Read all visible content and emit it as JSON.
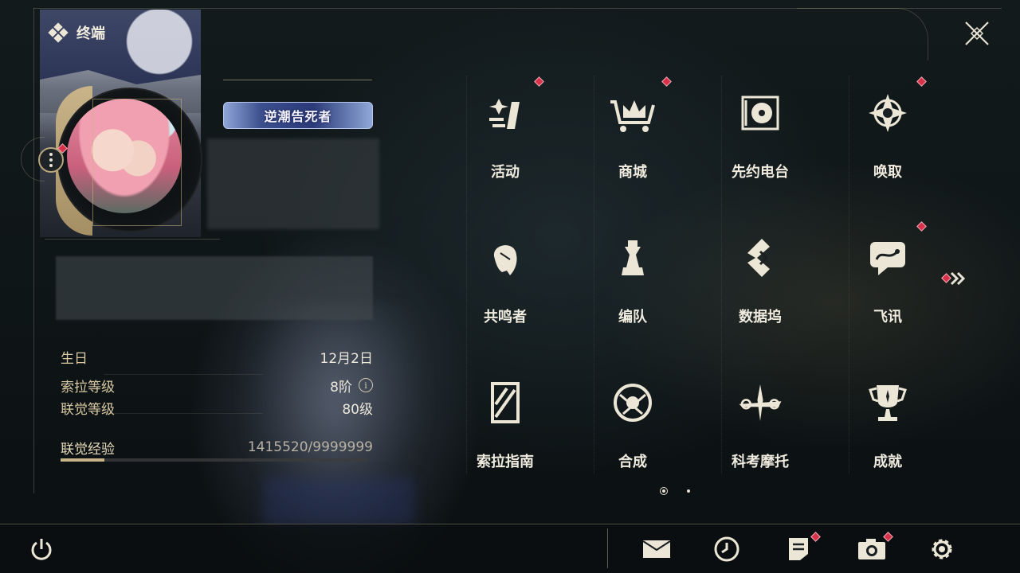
{
  "header": {
    "title": "终端"
  },
  "profile": {
    "title_badge": "逆潮告死者",
    "stats": [
      {
        "key": "生日",
        "value": "12月2日"
      },
      {
        "key": "索拉等级",
        "value": "8阶"
      },
      {
        "key": "联觉等级",
        "value": "80级"
      },
      {
        "key": "联觉经验",
        "value": "1415520/9999999"
      }
    ],
    "exp_progress": 0.1416
  },
  "menu": {
    "items": [
      {
        "label": "活动",
        "icon": "activity-icon",
        "badge": true
      },
      {
        "label": "商城",
        "icon": "shop-crown-cart-icon",
        "badge": true
      },
      {
        "label": "先约电台",
        "icon": "radio-vinyl-icon",
        "badge": false
      },
      {
        "label": "唤取",
        "icon": "convene-star-icon",
        "badge": true
      },
      {
        "label": "共鸣者",
        "icon": "resonator-head-icon",
        "badge": false
      },
      {
        "label": "编队",
        "icon": "team-chess-icon",
        "badge": false
      },
      {
        "label": "数据坞",
        "icon": "data-dock-icon",
        "badge": false
      },
      {
        "label": "飞讯",
        "icon": "chat-bubble-icon",
        "badge": true
      },
      {
        "label": "索拉指南",
        "icon": "guide-book-icon",
        "badge": false
      },
      {
        "label": "合成",
        "icon": "synthesis-circle-icon",
        "badge": false
      },
      {
        "label": "科考摩托",
        "icon": "motorbike-icon",
        "badge": false
      },
      {
        "label": "成就",
        "icon": "trophy-icon",
        "badge": false
      }
    ],
    "page_current": 1,
    "page_total": 2
  },
  "bottom_bar": {
    "icons": [
      "power-icon",
      "mail-icon",
      "clock-icon",
      "notes-icon",
      "camera-icon",
      "settings-gear-icon"
    ]
  },
  "colors": {
    "accent_gold": "#c9b48a",
    "badge_red": "#d8324a",
    "title_badge_blue": "#2b3a78"
  }
}
